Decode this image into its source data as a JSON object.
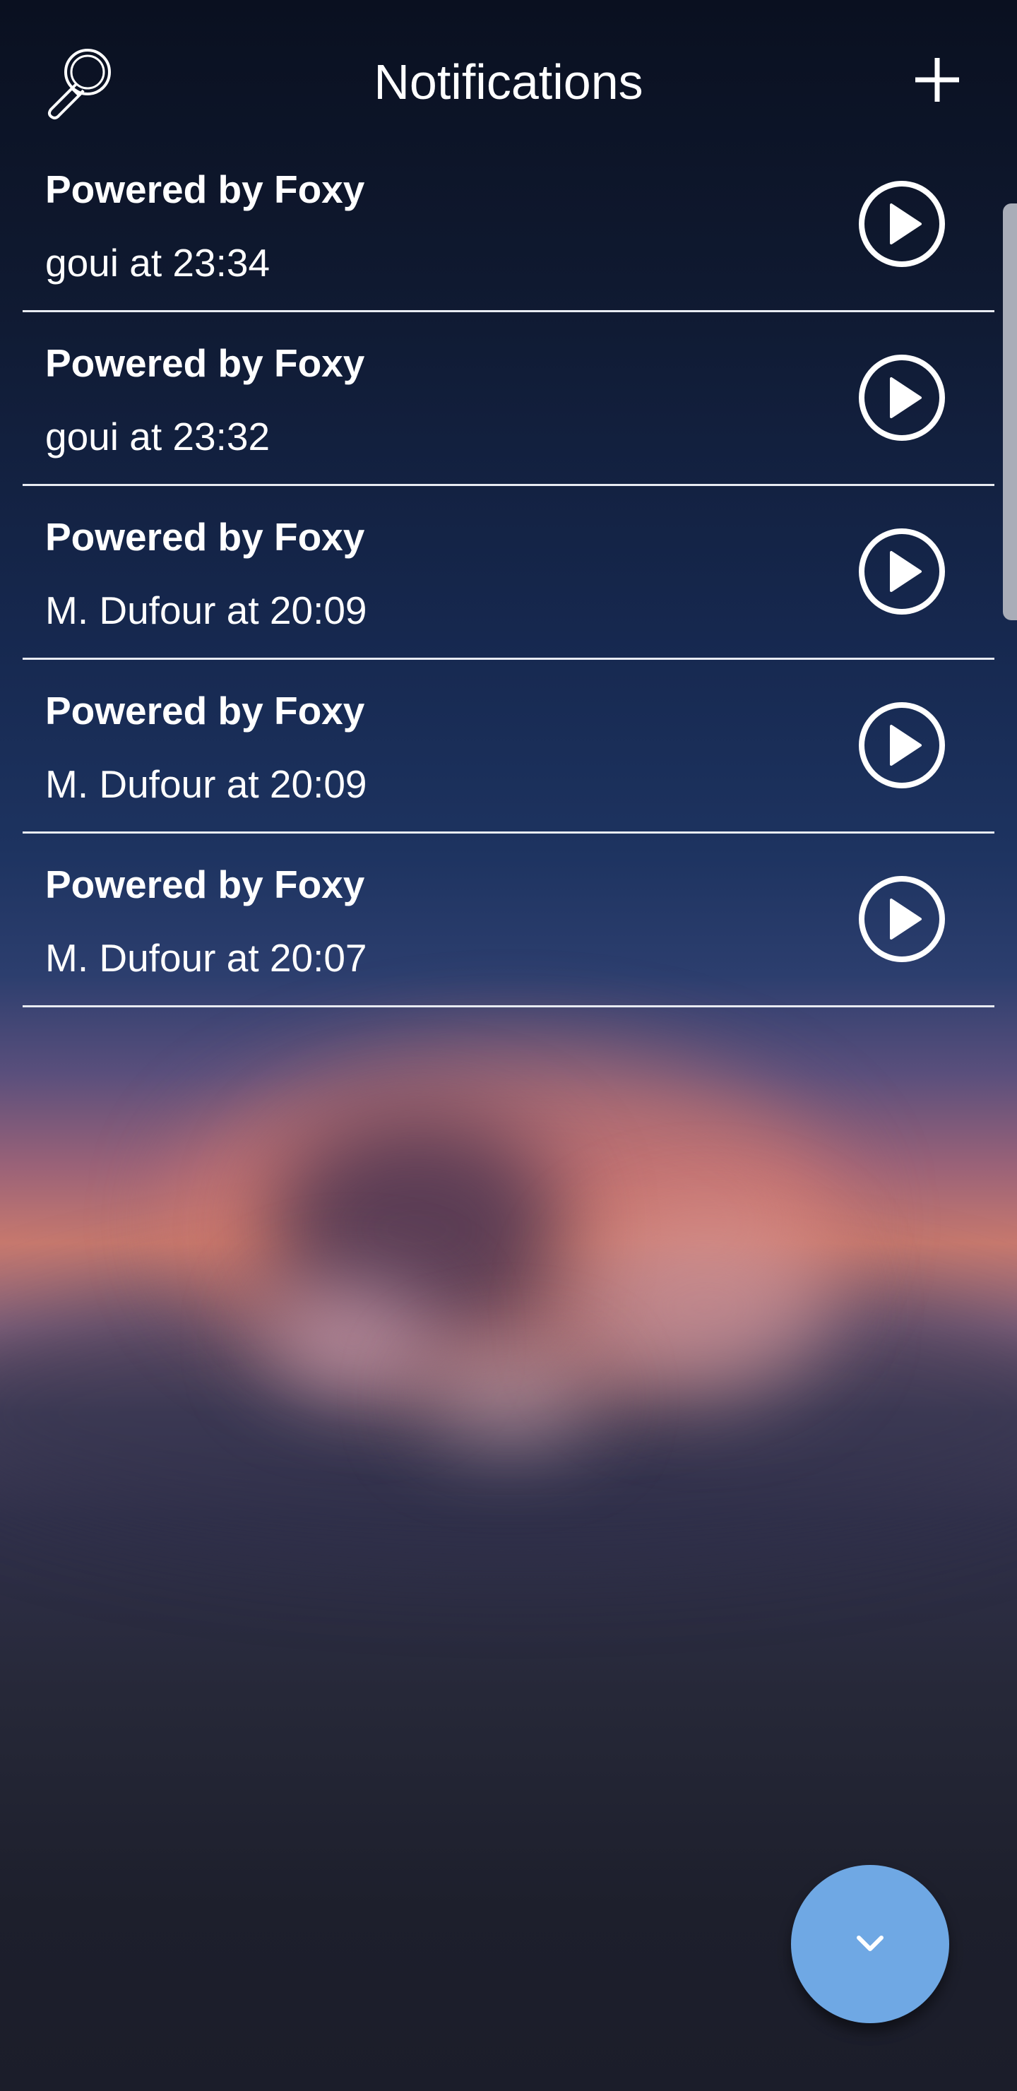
{
  "header": {
    "title": "Notifications",
    "search_icon": "magnifier-icon",
    "add_icon": "plus-icon"
  },
  "notifications": [
    {
      "title": "Powered by Foxy",
      "subtitle": "goui at 23:34"
    },
    {
      "title": "Powered by Foxy",
      "subtitle": "goui at 23:32"
    },
    {
      "title": "Powered by Foxy",
      "subtitle": "M. Dufour at 20:09"
    },
    {
      "title": "Powered by Foxy",
      "subtitle": "M. Dufour at 20:09"
    },
    {
      "title": "Powered by Foxy",
      "subtitle": "M. Dufour at 20:07"
    }
  ],
  "fab": {
    "icon": "chevron-down-icon",
    "color": "#6fa8e4"
  },
  "colors": {
    "text": "#ffffff",
    "divider": "#e8ebf2"
  }
}
